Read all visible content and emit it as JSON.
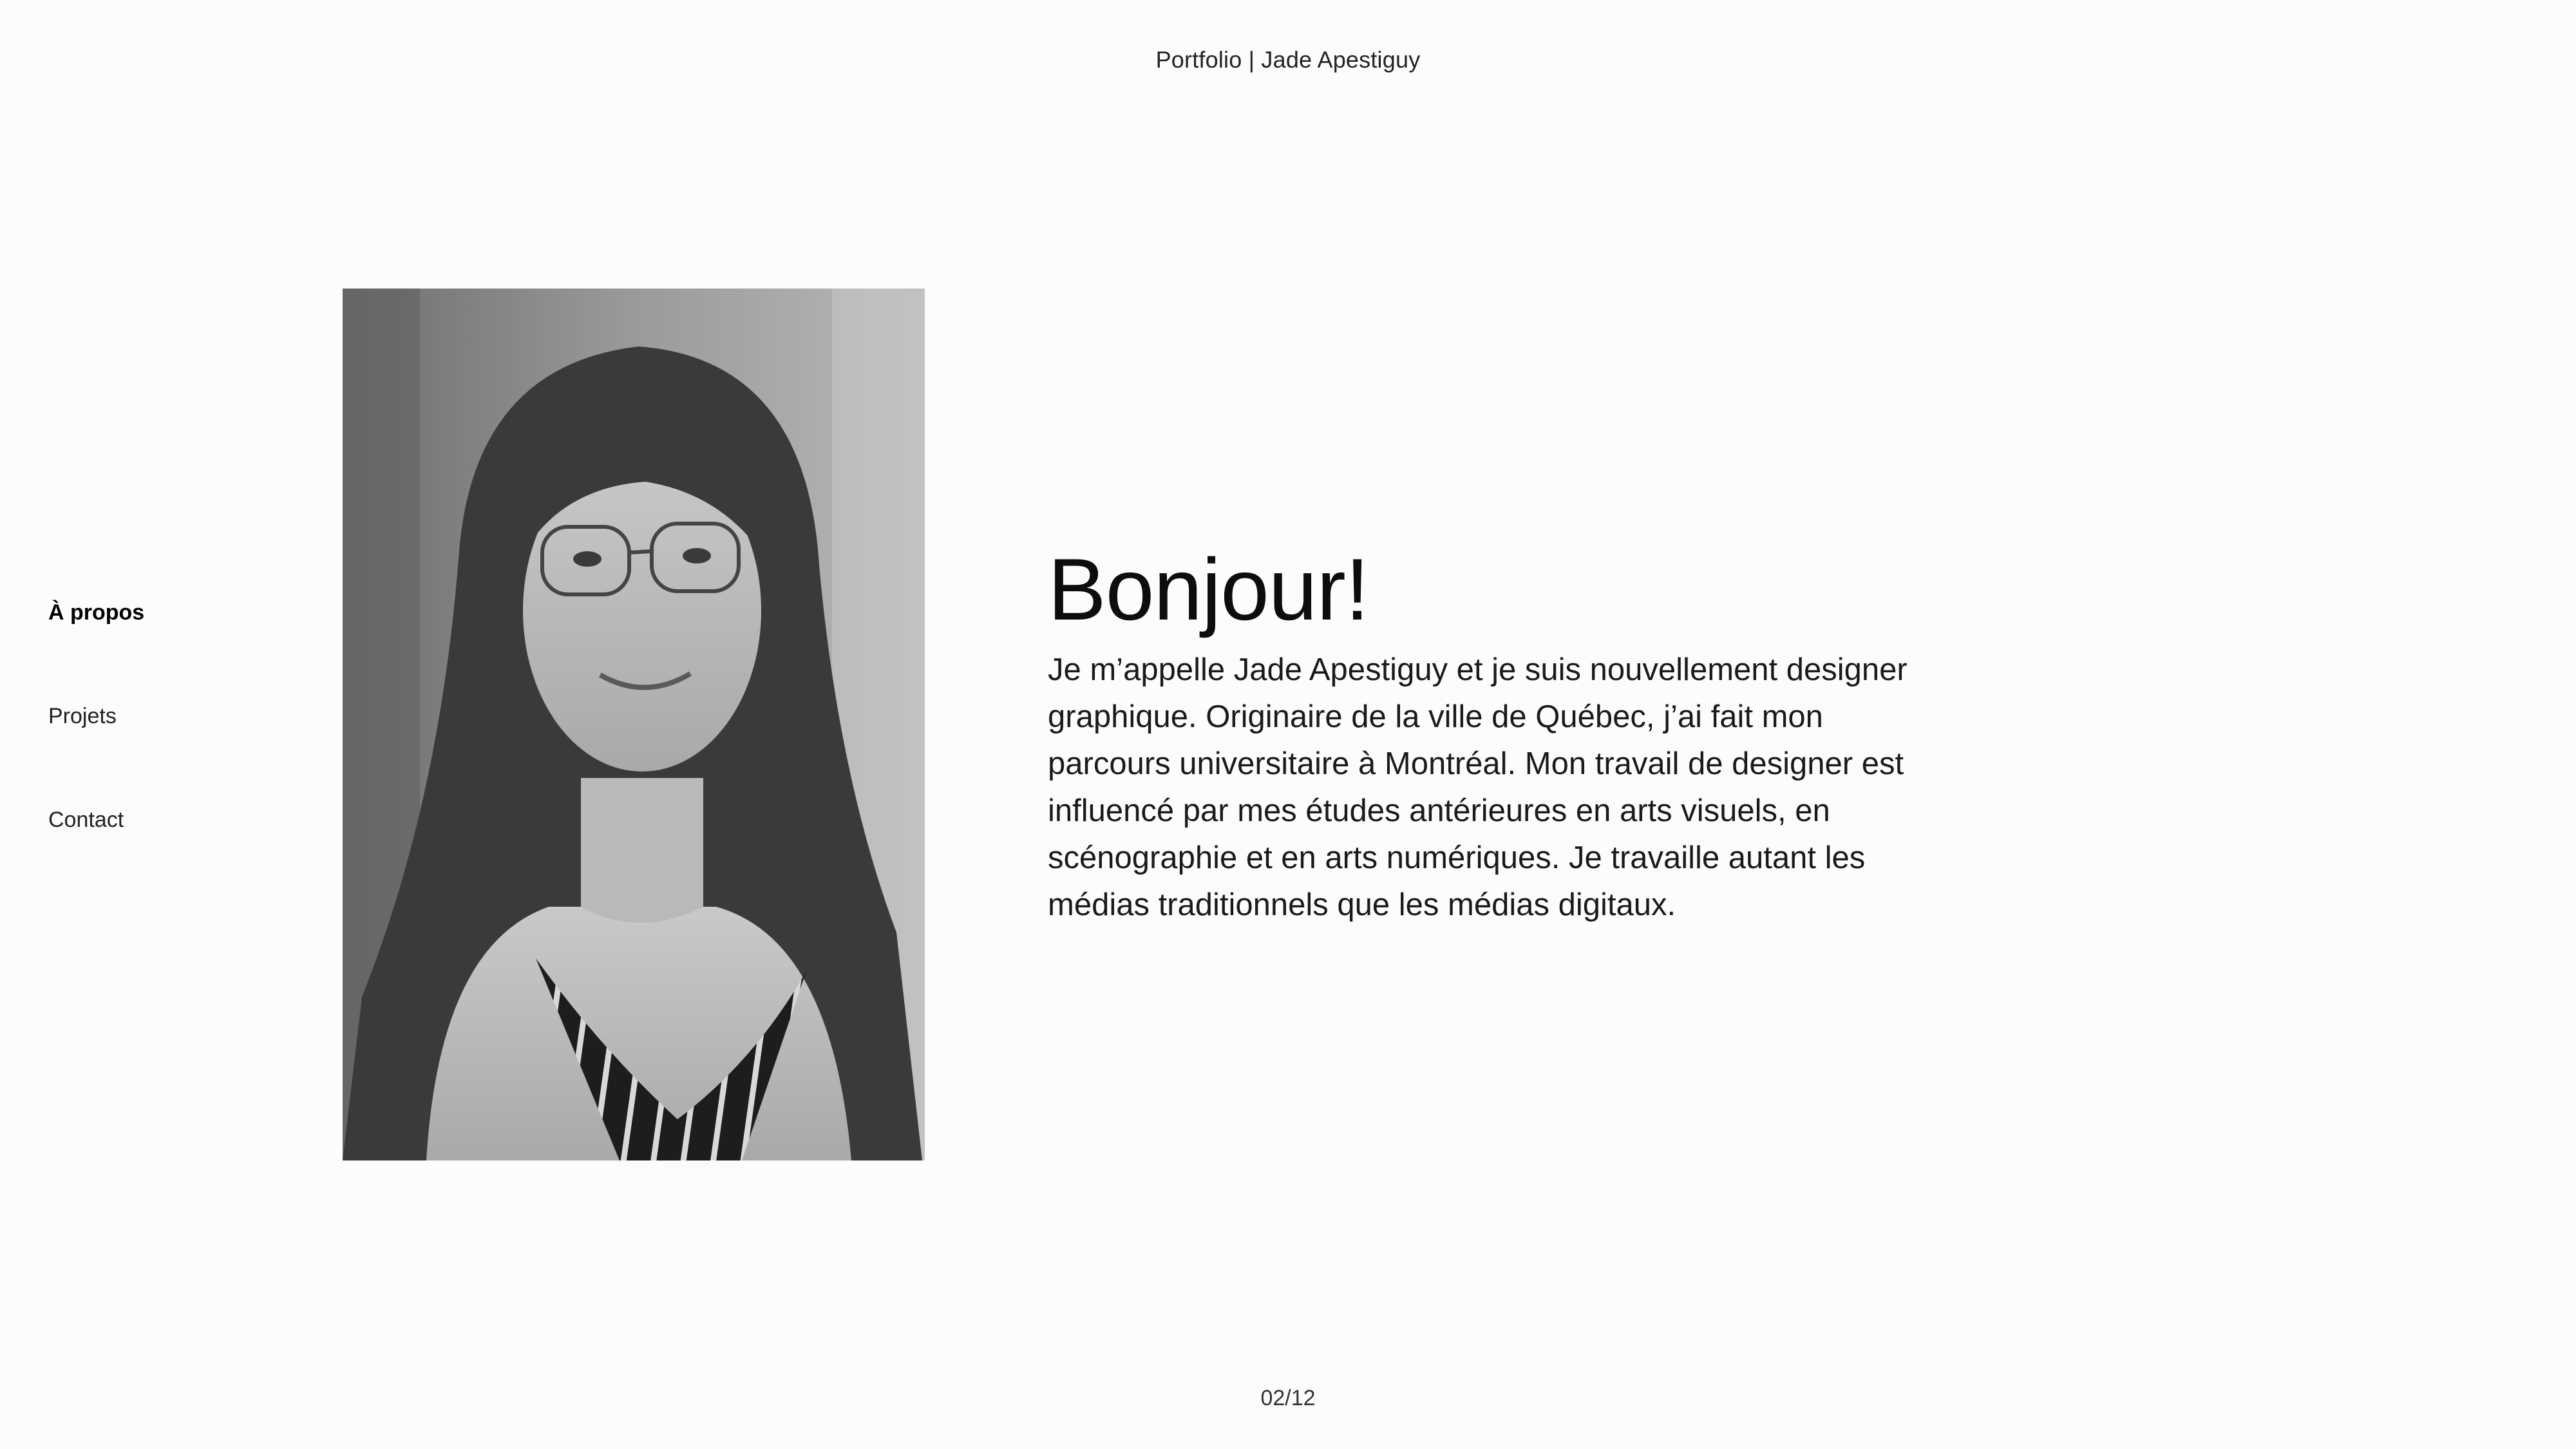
{
  "header": {
    "title": "Portfolio | Jade Apestiguy"
  },
  "nav": {
    "items": [
      {
        "label": "À propos",
        "active": true
      },
      {
        "label": "Projets",
        "active": false
      },
      {
        "label": "Contact",
        "active": false
      }
    ]
  },
  "intro": {
    "heading": "Bonjour!",
    "bio": "Je m’appelle Jade Apestiguy et je suis nouvellement designer graphique. Originaire de la ville de Québec, j’ai fait mon parcours universitaire à Montréal. Mon travail de designer est influencé par mes études antérieures en arts visuels, en scénographie et en arts numériques. Je travaille autant les médias traditionnels que les médias digitaux."
  },
  "portrait": {
    "style": "black-and-white photo"
  },
  "footer": {
    "page_counter": "02/12"
  },
  "colors": {
    "background": "#fdfcfa",
    "text": "#111111"
  }
}
